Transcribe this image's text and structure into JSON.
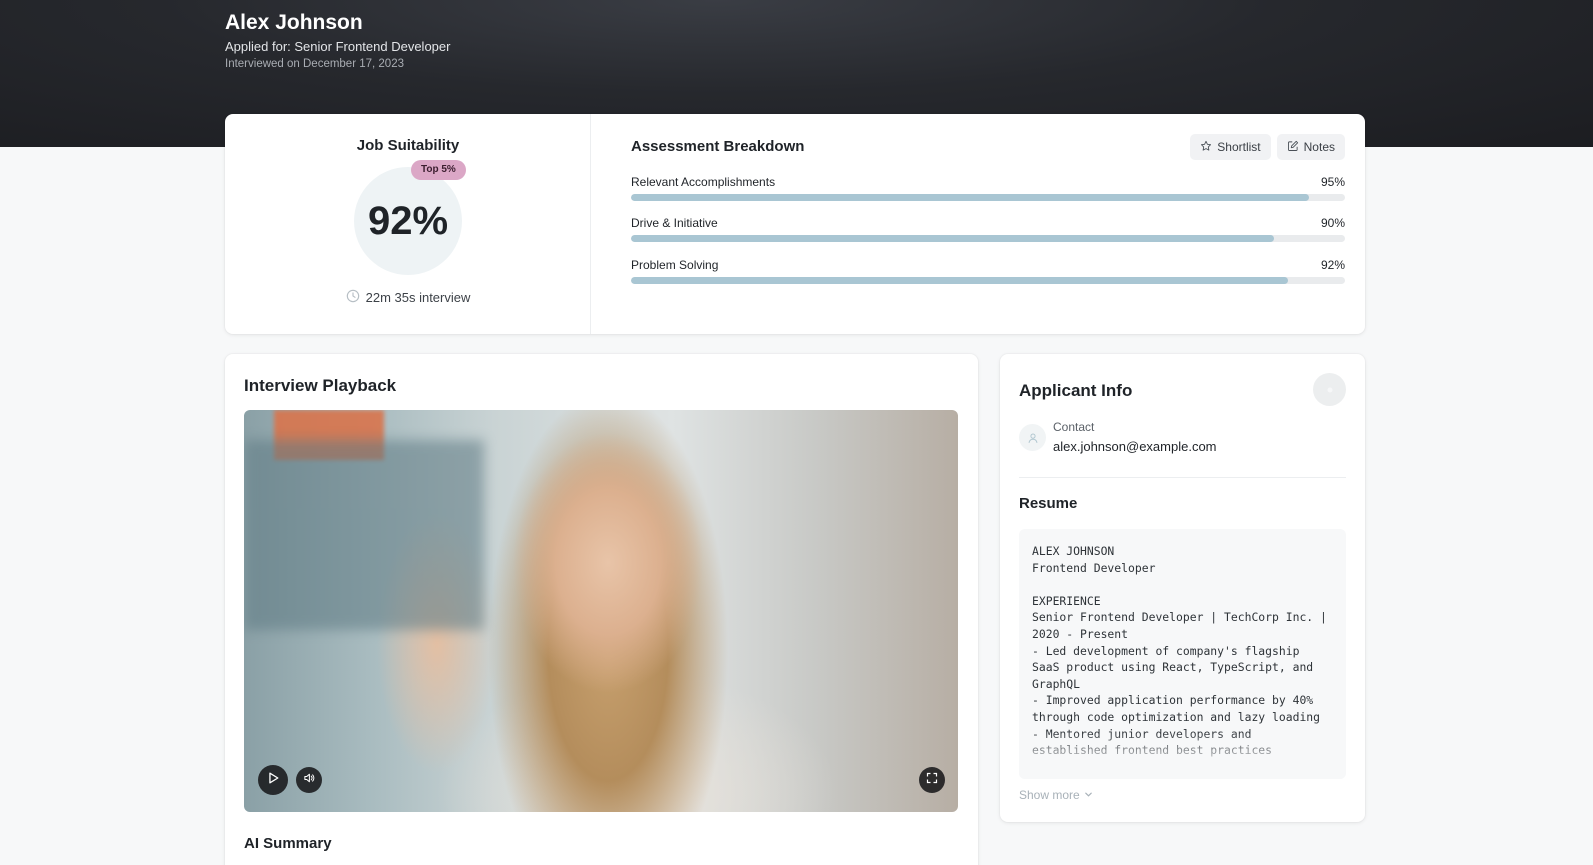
{
  "header": {
    "name": "Alex Johnson",
    "applied_for": "Applied for: Senior Frontend Developer",
    "interview_date": "Interviewed on December 17, 2023"
  },
  "suitability": {
    "title": "Job Suitability",
    "score": "92%",
    "badge": "Top 5%",
    "duration": "22m 35s interview"
  },
  "breakdown": {
    "title": "Assessment Breakdown",
    "shortlist_label": "Shortlist",
    "notes_label": "Notes",
    "metrics": [
      {
        "label": "Relevant Accomplishments",
        "value_text": "95%",
        "value": 95
      },
      {
        "label": "Drive & Initiative",
        "value_text": "90%",
        "value": 90
      },
      {
        "label": "Problem Solving",
        "value_text": "92%",
        "value": 92
      }
    ]
  },
  "playback": {
    "title": "Interview Playback",
    "ai_summary_title": "AI Summary"
  },
  "applicant": {
    "title": "Applicant Info",
    "contact_label": "Contact",
    "email": "alex.johnson@example.com",
    "resume_title": "Resume",
    "resume_text": "ALEX JOHNSON\nFrontend Developer\n\nEXPERIENCE\nSenior Frontend Developer | TechCorp Inc. | 2020 - Present\n- Led development of company's flagship SaaS product using React, TypeScript, and GraphQL\n- Improved application performance by 40% through code optimization and lazy loading\n- Mentored junior developers and established frontend best practices",
    "show_more_label": "Show more"
  },
  "colors": {
    "badge": "#dba7c6",
    "bar_fill": "#a9c6d3",
    "bar_track": "#e9ebed",
    "hero_bg": "#26282d"
  },
  "icons": {
    "shortlist": "star-icon",
    "notes": "edit-icon",
    "duration": "clock-icon",
    "play": "play-icon",
    "volume": "volume-icon",
    "fullscreen": "fullscreen-icon",
    "contact": "user-icon",
    "show_more": "chevron-down-icon"
  }
}
